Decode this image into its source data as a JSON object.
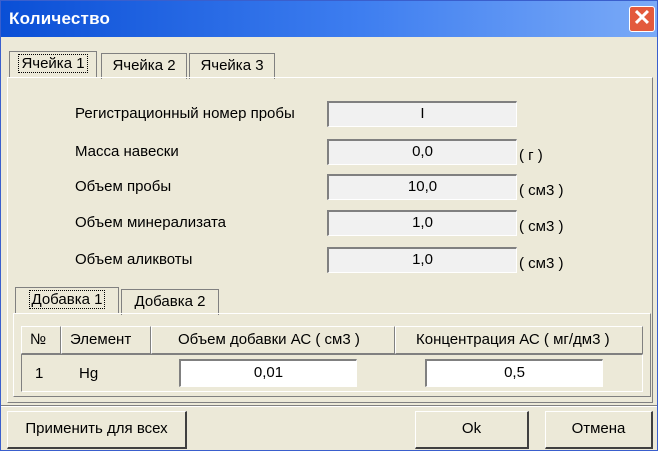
{
  "window": {
    "title": "Количество",
    "close_glyph": "✕"
  },
  "tabs": [
    {
      "label": "Ячейка 1",
      "active": true
    },
    {
      "label": "Ячейка 2",
      "active": false
    },
    {
      "label": "Ячейка 3",
      "active": false
    }
  ],
  "fields": [
    {
      "label": "Регистрационный номер пробы",
      "value": "I",
      "unit": ""
    },
    {
      "label": "Масса навески",
      "value": "0,0",
      "unit": "( г )"
    },
    {
      "label": "Объем пробы",
      "value": "10,0",
      "unit": "( см3 )"
    },
    {
      "label": "Объем минерализата",
      "value": "1,0",
      "unit": "( см3 )"
    },
    {
      "label": "Объем аликвоты",
      "value": "1,0",
      "unit": "( см3 )"
    }
  ],
  "additive_tabs": [
    {
      "label": "Добавка 1",
      "active": true
    },
    {
      "label": "Добавка 2",
      "active": false
    }
  ],
  "grid": {
    "columns": [
      "№",
      "Элемент",
      "Объем добавки АС ( см3 )",
      "Концентрация АС ( мг/дм3 )"
    ],
    "rows": [
      {
        "num": "1",
        "element": "Hg",
        "volume": "0,01",
        "concentration": "0,5"
      }
    ]
  },
  "buttons": {
    "apply_all": "Применить для всех",
    "ok": "Ok",
    "cancel": "Отмена"
  }
}
